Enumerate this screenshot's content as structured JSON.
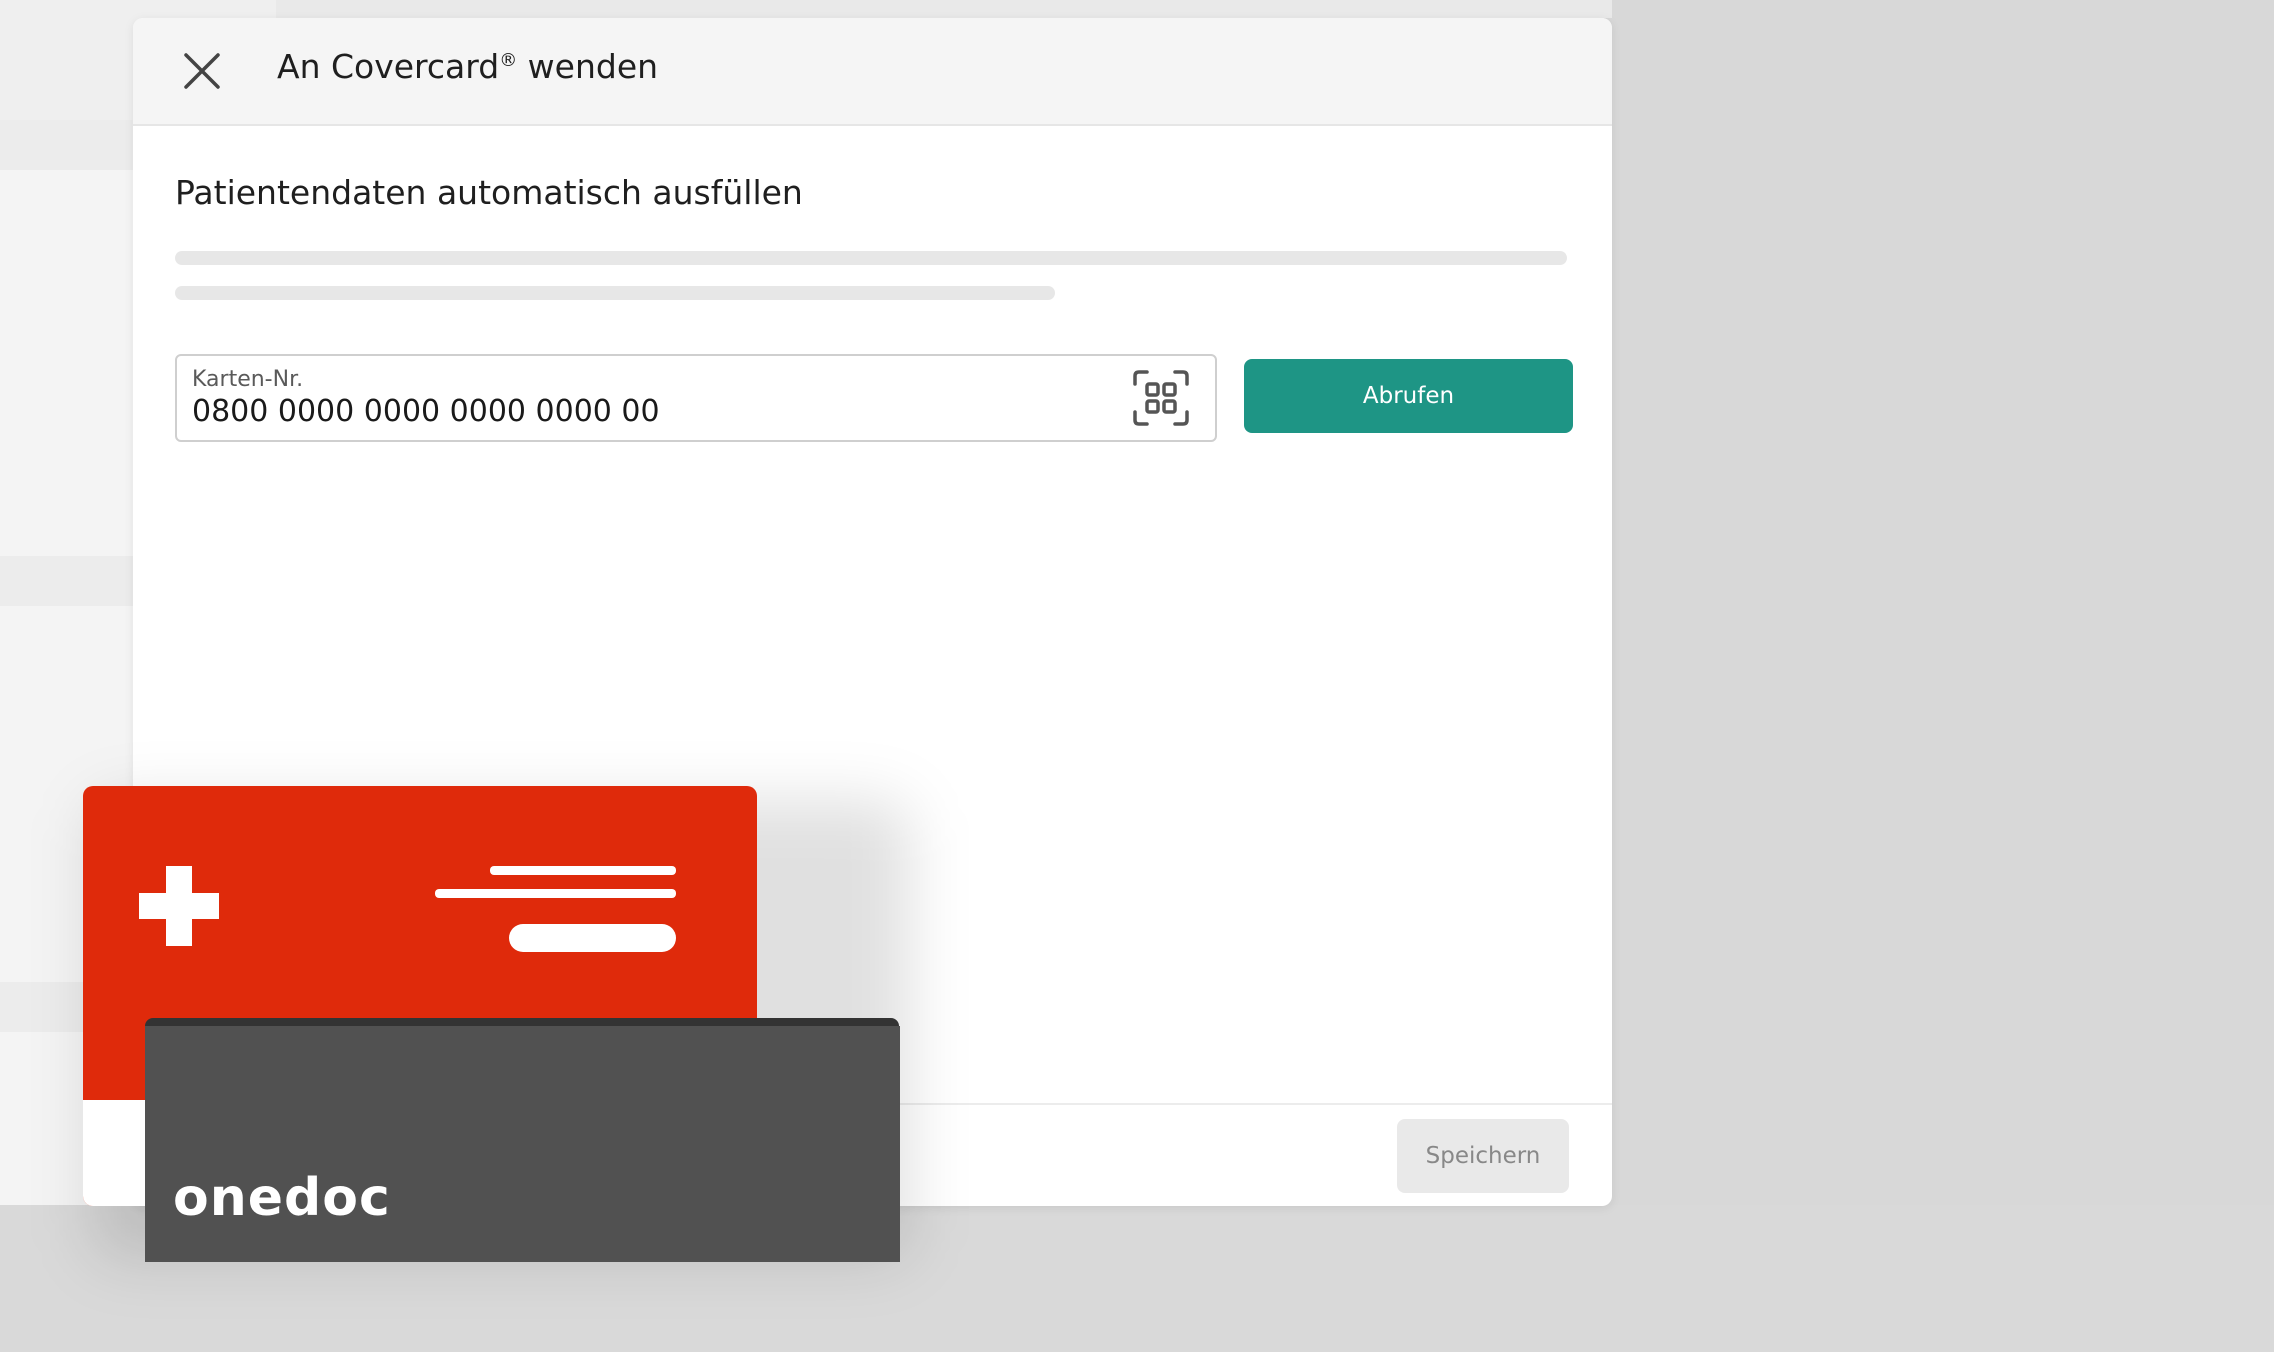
{
  "modal": {
    "title": "An Covercard",
    "title_mark": "®",
    "title_suffix": " wenden",
    "section_title": "Patientendaten automatisch ausfüllen",
    "card_field": {
      "label": "Karten-Nr.",
      "value": "0800 0000 0000 0000 0000 00"
    },
    "fetch_button": "Abrufen",
    "save_button": "Speichern"
  },
  "overlay": {
    "brand": "onedoc"
  },
  "colors": {
    "accent": "#1e9585",
    "card_red": "#df2a0b",
    "card_dark": "#515151",
    "chip": "#f1b36c"
  },
  "icons": [
    "close-icon",
    "scan-icon",
    "swiss-cross-icon"
  ]
}
